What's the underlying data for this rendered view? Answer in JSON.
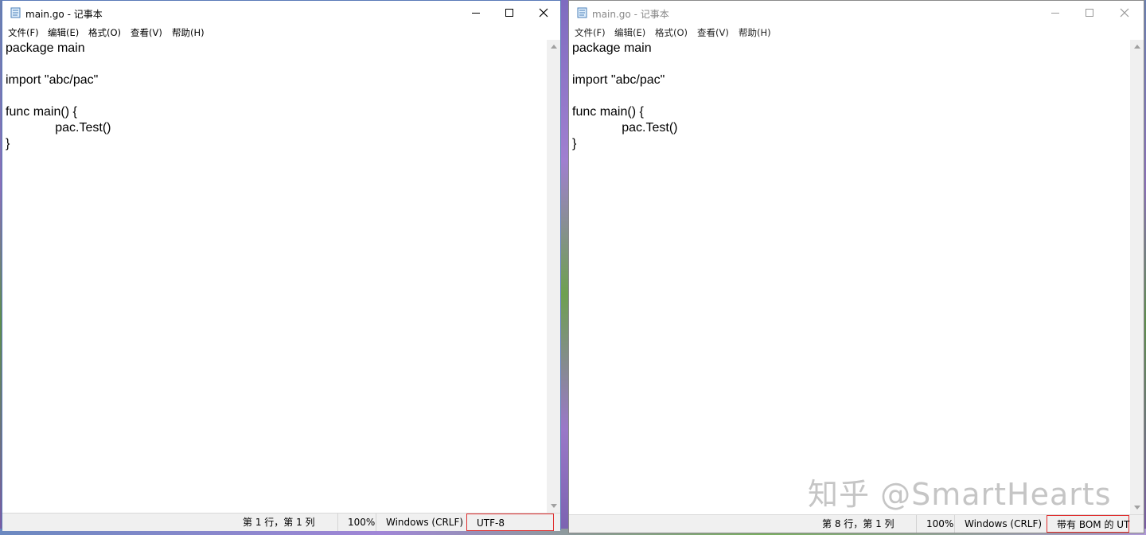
{
  "windows": [
    {
      "title": "main.go - 记事本",
      "menu": [
        "文件(F)",
        "编辑(E)",
        "格式(O)",
        "查看(V)",
        "帮助(H)"
      ],
      "lines": [
        "package main",
        "",
        "import \"abc/pac\"",
        "",
        "func main() {",
        "              pac.Test()",
        "}"
      ],
      "status": {
        "position": "第 1 行，第 1 列",
        "zoom": "100%",
        "line_ending": "Windows (CRLF)",
        "encoding": "UTF-8"
      }
    },
    {
      "title": "main.go - 记事本",
      "menu": [
        "文件(F)",
        "编辑(E)",
        "格式(O)",
        "查看(V)",
        "帮助(H)"
      ],
      "lines": [
        "package main",
        "",
        "import \"abc/pac\"",
        "",
        "func main() {",
        "              pac.Test()",
        "}"
      ],
      "status": {
        "position": "第 8 行，第 1 列",
        "zoom": "100%",
        "line_ending": "Windows (CRLF)",
        "encoding": "带有 BOM 的 UT"
      }
    }
  ],
  "watermark": "知乎 @SmartHearts",
  "icons": [
    "notepad-icon",
    "minimize-icon",
    "maximize-icon",
    "close-icon",
    "scroll-up-arrow-icon",
    "scroll-down-arrow-icon"
  ],
  "colors": {
    "highlight_box": "#e03030",
    "statusbar_bg": "#f0f0f0"
  }
}
